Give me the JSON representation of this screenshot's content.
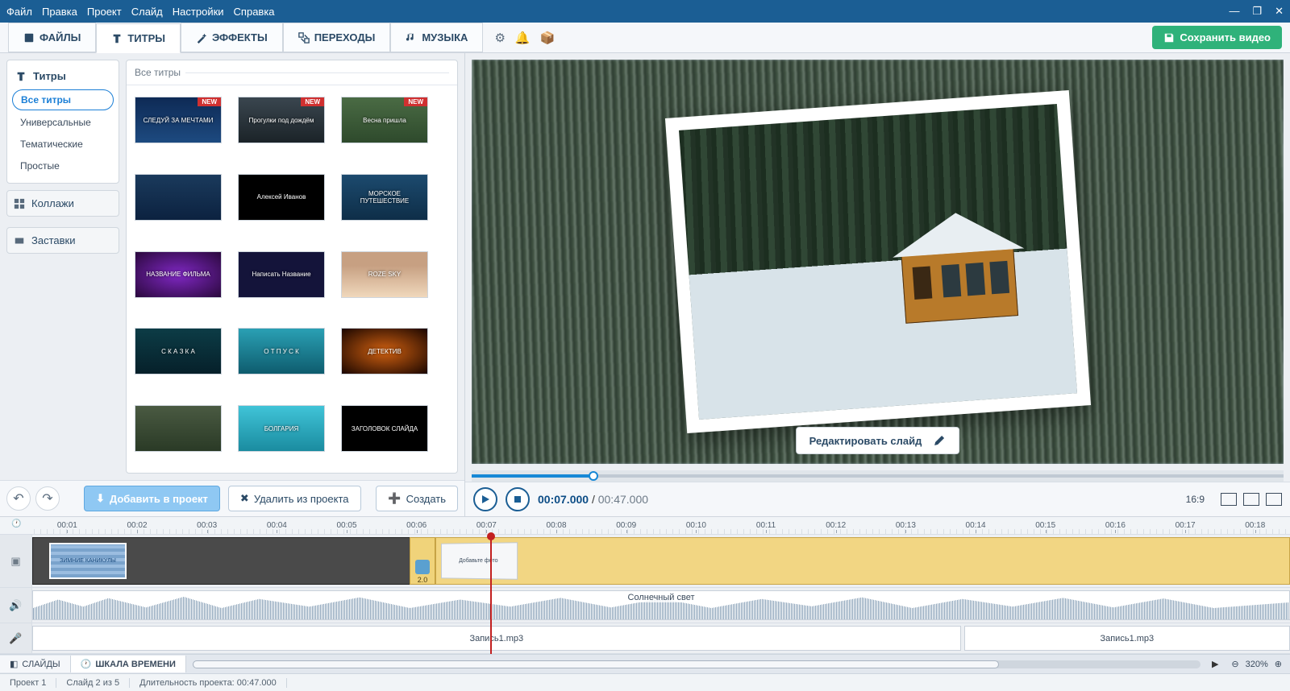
{
  "menubar": [
    "Файл",
    "Правка",
    "Проект",
    "Слайд",
    "Настройки",
    "Справка"
  ],
  "main_tabs": {
    "files": "ФАЙЛЫ",
    "titles": "ТИТРЫ",
    "effects": "ЭФФЕКТЫ",
    "transitions": "ПЕРЕХОДЫ",
    "music": "МУЗЫКА"
  },
  "save_button_label": "Сохранить видео",
  "sidebar": {
    "section_head": "Титры",
    "tags": {
      "all": "Все титры",
      "universal": "Универсальные",
      "thematic": "Тематические",
      "simple": "Простые"
    },
    "btn_collages": "Коллажи",
    "btn_intros": "Заставки"
  },
  "gallery": {
    "header": "Все титры",
    "new_badge": "NEW",
    "items": [
      {
        "label": "СЛЕДУЙ ЗА МЕЧТАМИ",
        "bg": "linear-gradient(#0e2a55,#1d4a80)",
        "new": true
      },
      {
        "label": "Прогулки под дождём",
        "bg": "linear-gradient(#3a464f,#1b2328)",
        "new": true
      },
      {
        "label": "Весна пришла",
        "bg": "linear-gradient(#4a6b44,#2e4a2c)",
        "new": true
      },
      {
        "label": "",
        "bg": "linear-gradient(#1a3a5c,#0c2240)",
        "new": false
      },
      {
        "label": "Алексей Иванов",
        "bg": "#000",
        "new": false
      },
      {
        "label": "МОРСКОЕ ПУТЕШЕСТВИЕ",
        "bg": "linear-gradient(#1c4a6e,#0e2e48)",
        "new": false
      },
      {
        "label": "НАЗВАНИЕ ФИЛЬМА",
        "bg": "radial-gradient(#8028c4,#2a083c)",
        "new": false
      },
      {
        "label": "Написать Название",
        "bg": "#14143a",
        "new": false
      },
      {
        "label": "ROZE SKY",
        "bg": "linear-gradient(#c7a082 30%,#f0d8bc)",
        "new": false
      },
      {
        "label": "С К А З К А",
        "bg": "linear-gradient(#0c3c46,#06202a)",
        "new": false
      },
      {
        "label": "О Т П У С К",
        "bg": "linear-gradient(#2aa0b4,#0e5c6e)",
        "new": false
      },
      {
        "label": "ДЕТЕКТИВ",
        "bg": "radial-gradient(#d06010,#1a0600)",
        "new": false
      },
      {
        "label": "",
        "bg": "linear-gradient(#4a5a42,#2a3a26)",
        "new": false
      },
      {
        "label": "БОЛГАРИЯ",
        "bg": "linear-gradient(#40c4d8,#1a8ca0)",
        "new": false
      },
      {
        "label": "ЗАГОЛОВОК СЛАЙДА",
        "bg": "#000",
        "new": false
      }
    ]
  },
  "actions": {
    "add_to_project": "Добавить в проект",
    "remove_from_project": "Удалить из проекта",
    "create": "Создать"
  },
  "preview": {
    "edit_slide_label": "Редактировать слайд"
  },
  "playback": {
    "current_time": "00:07.000",
    "total_time": "00:47.000",
    "aspect_ratio": "16:9"
  },
  "timeline": {
    "ruler_marks": [
      "00:01",
      "00:02",
      "00:03",
      "00:04",
      "00:05",
      "00:06",
      "00:07",
      "00:08",
      "00:09",
      "00:10",
      "00:11",
      "00:12",
      "00:13",
      "00:14",
      "00:15",
      "00:16",
      "00:17",
      "00:18"
    ],
    "clip1_label": "ЗИМНИЕ КАНИКУЛЫ",
    "transition_duration": "2.0",
    "clip2_label": "Добавьте фото",
    "audio_label": "Солнечный свет",
    "voice_clip_label": "Запись1.mp3",
    "tab_slides": "СЛАЙДЫ",
    "tab_timeline": "ШКАЛА ВРЕМЕНИ",
    "zoom": "320%"
  },
  "statusbar": {
    "project_name": "Проект 1",
    "slide_info": "Слайд 2 из 5",
    "duration_label": "Длительность проекта: 00:47.000"
  }
}
